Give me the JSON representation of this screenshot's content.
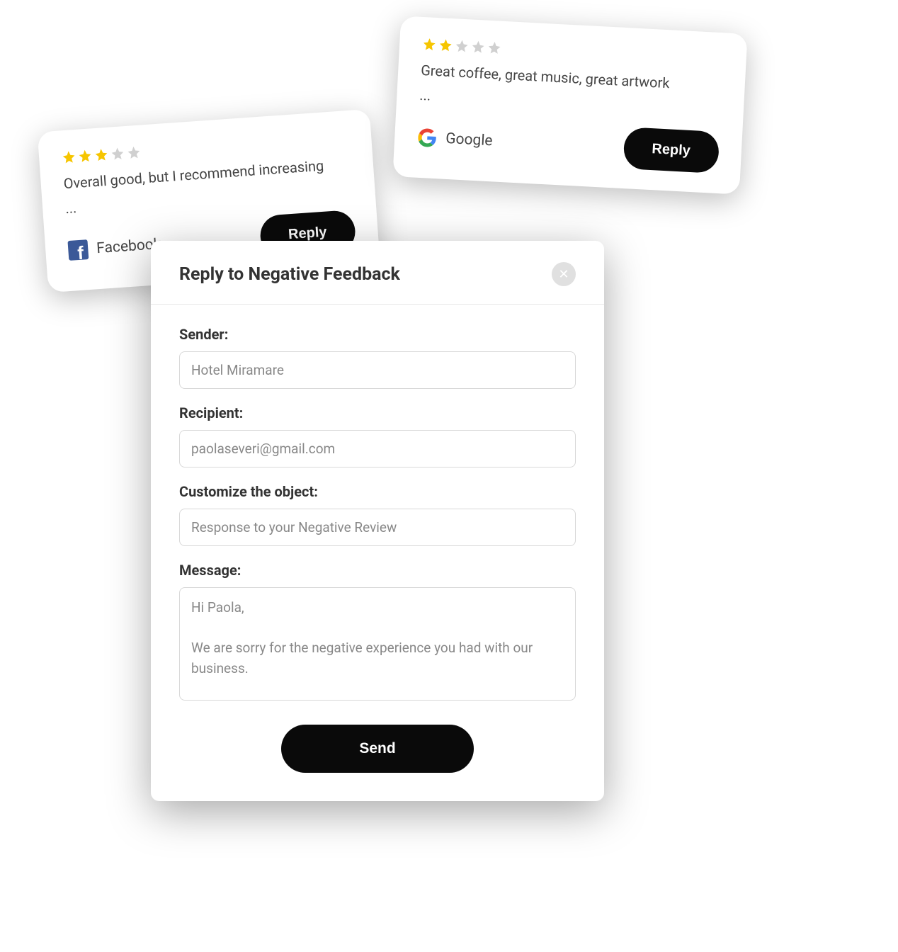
{
  "reviews": [
    {
      "rating": 3,
      "text": "Overall good, but I recommend increasing",
      "ellipsis": "...",
      "source": "Facebook",
      "reply_label": "Reply"
    },
    {
      "rating": 2,
      "text": "Great coffee, great music, great artwork",
      "ellipsis": "...",
      "source": "Google",
      "reply_label": "Reply"
    }
  ],
  "modal": {
    "title": "Reply to Negative Feedback",
    "sender_label": "Sender:",
    "sender_value": "Hotel Miramare",
    "recipient_label": "Recipient:",
    "recipient_value": "paolaseveri@gmail.com",
    "subject_label": "Customize the object:",
    "subject_value": "Response to your Negative Review",
    "message_label": "Message:",
    "message_value": "Hi Paola,\n\nWe are sorry for the negative experience you had with our business.",
    "send_label": "Send"
  },
  "colors": {
    "star_filled": "#f6c500",
    "star_empty": "#d0d0d0",
    "button_bg": "#0a0a0a"
  }
}
